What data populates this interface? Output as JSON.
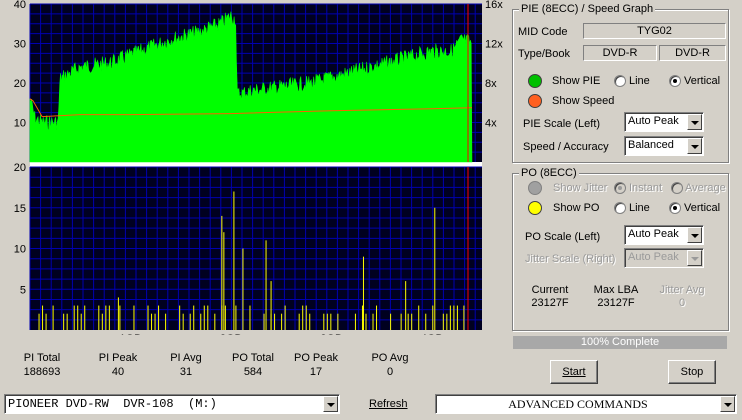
{
  "chart_data": [
    {
      "type": "area",
      "title": "",
      "y_left_ticks": [
        "40",
        "30",
        "20",
        "10"
      ],
      "y_right_ticks": [
        "16x",
        "12x",
        "8x",
        "4x"
      ],
      "ylim_left": [
        0,
        40
      ],
      "ylim_right": [
        0,
        16
      ],
      "grid": true,
      "series": [
        {
          "name": "PIE",
          "color": "#00ff00",
          "x_gb": [
            0.0,
            0.05,
            0.12,
            0.28,
            0.3,
            0.5,
            0.8,
            1.1,
            1.4,
            1.7,
            1.9,
            2.0,
            2.05,
            2.06,
            2.2,
            2.5,
            2.8,
            3.1,
            3.4,
            3.7,
            4.0,
            4.2,
            4.3,
            4.4
          ],
          "values": [
            18,
            13,
            12,
            12,
            23,
            26,
            27,
            30,
            33,
            35,
            37,
            39,
            38,
            19,
            20,
            21,
            22,
            24,
            26,
            28,
            30,
            30,
            33,
            32
          ]
        },
        {
          "name": "Speed",
          "color": "#ff6000",
          "x_gb": [
            0.0,
            0.03,
            0.12,
            0.5,
            1.0,
            2.0,
            3.0,
            4.0,
            4.4
          ],
          "values_x": [
            6.4,
            6.2,
            4.6,
            4.8,
            4.8,
            4.9,
            5.2,
            5.4,
            5.5
          ]
        }
      ]
    },
    {
      "type": "bar",
      "title": "",
      "y_ticks": [
        "20",
        "15",
        "10",
        "5"
      ],
      "ylim": [
        0,
        20
      ],
      "x_ticks": [
        "1GB",
        "2GB",
        "3GB",
        "4GB"
      ],
      "grid": true,
      "series": [
        {
          "name": "PO",
          "color": "#ffff00",
          "spikes": [
            {
              "x": 0.88,
              "v": 4
            },
            {
              "x": 1.91,
              "v": 14
            },
            {
              "x": 1.93,
              "v": 12
            },
            {
              "x": 2.03,
              "v": 17
            },
            {
              "x": 2.12,
              "v": 10
            },
            {
              "x": 2.35,
              "v": 11
            },
            {
              "x": 2.4,
              "v": 6
            },
            {
              "x": 3.32,
              "v": 9
            },
            {
              "x": 3.74,
              "v": 6
            },
            {
              "x": 4.03,
              "v": 15
            },
            {
              "x": 4.32,
              "v": 3
            }
          ]
        }
      ]
    }
  ],
  "stats": [
    {
      "label": "PI Total",
      "value": "188693"
    },
    {
      "label": "PI Peak",
      "value": "40"
    },
    {
      "label": "PI Avg",
      "value": "31"
    },
    {
      "label": "PO Total",
      "value": "584"
    },
    {
      "label": "PO Peak",
      "value": "17"
    },
    {
      "label": "PO Avg",
      "value": "0"
    }
  ],
  "pie_panel": {
    "title": "PIE (8ECC) / Speed Graph",
    "mid_label": "MID Code",
    "mid_value": "TYG02",
    "type_label": "Type/Book",
    "type_value": "DVD-R",
    "book_value": "DVD-R",
    "show_pie": "Show PIE",
    "line": "Line",
    "vertical": "Vertical",
    "show_speed": "Show Speed",
    "scale_label": "PIE Scale (Left)",
    "scale_value": "Auto Peak",
    "accuracy_label": "Speed / Accuracy",
    "accuracy_value": "Balanced",
    "pie_color": "#00c000",
    "speed_color": "#ff6020"
  },
  "po_panel": {
    "title": "PO (8ECC)",
    "show_jitter": "Show Jitter",
    "instant": "Instant",
    "average": "Average",
    "show_po": "Show PO",
    "line": "Line",
    "vertical": "Vertical",
    "scale_label": "PO Scale (Left)",
    "scale_value": "Auto Peak",
    "jitter_scale_label": "Jitter Scale (Right)",
    "jitter_scale_value": "Auto Peak",
    "current_label": "Current",
    "current_value": "23127F",
    "maxlba_label": "Max LBA",
    "maxlba_value": "23127F",
    "jitter_avg_label": "Jitter Avg",
    "jitter_avg_value": "0",
    "po_color": "#ffff00"
  },
  "progress": {
    "text": "100% Complete",
    "value": 1.0
  },
  "buttons": {
    "start": "Start",
    "stop": "Stop"
  },
  "footer": {
    "drive": "PIONEER DVD-RW  DVR-108  (M:)",
    "refresh": "Refresh",
    "commands": "ADVANCED COMMANDS"
  }
}
